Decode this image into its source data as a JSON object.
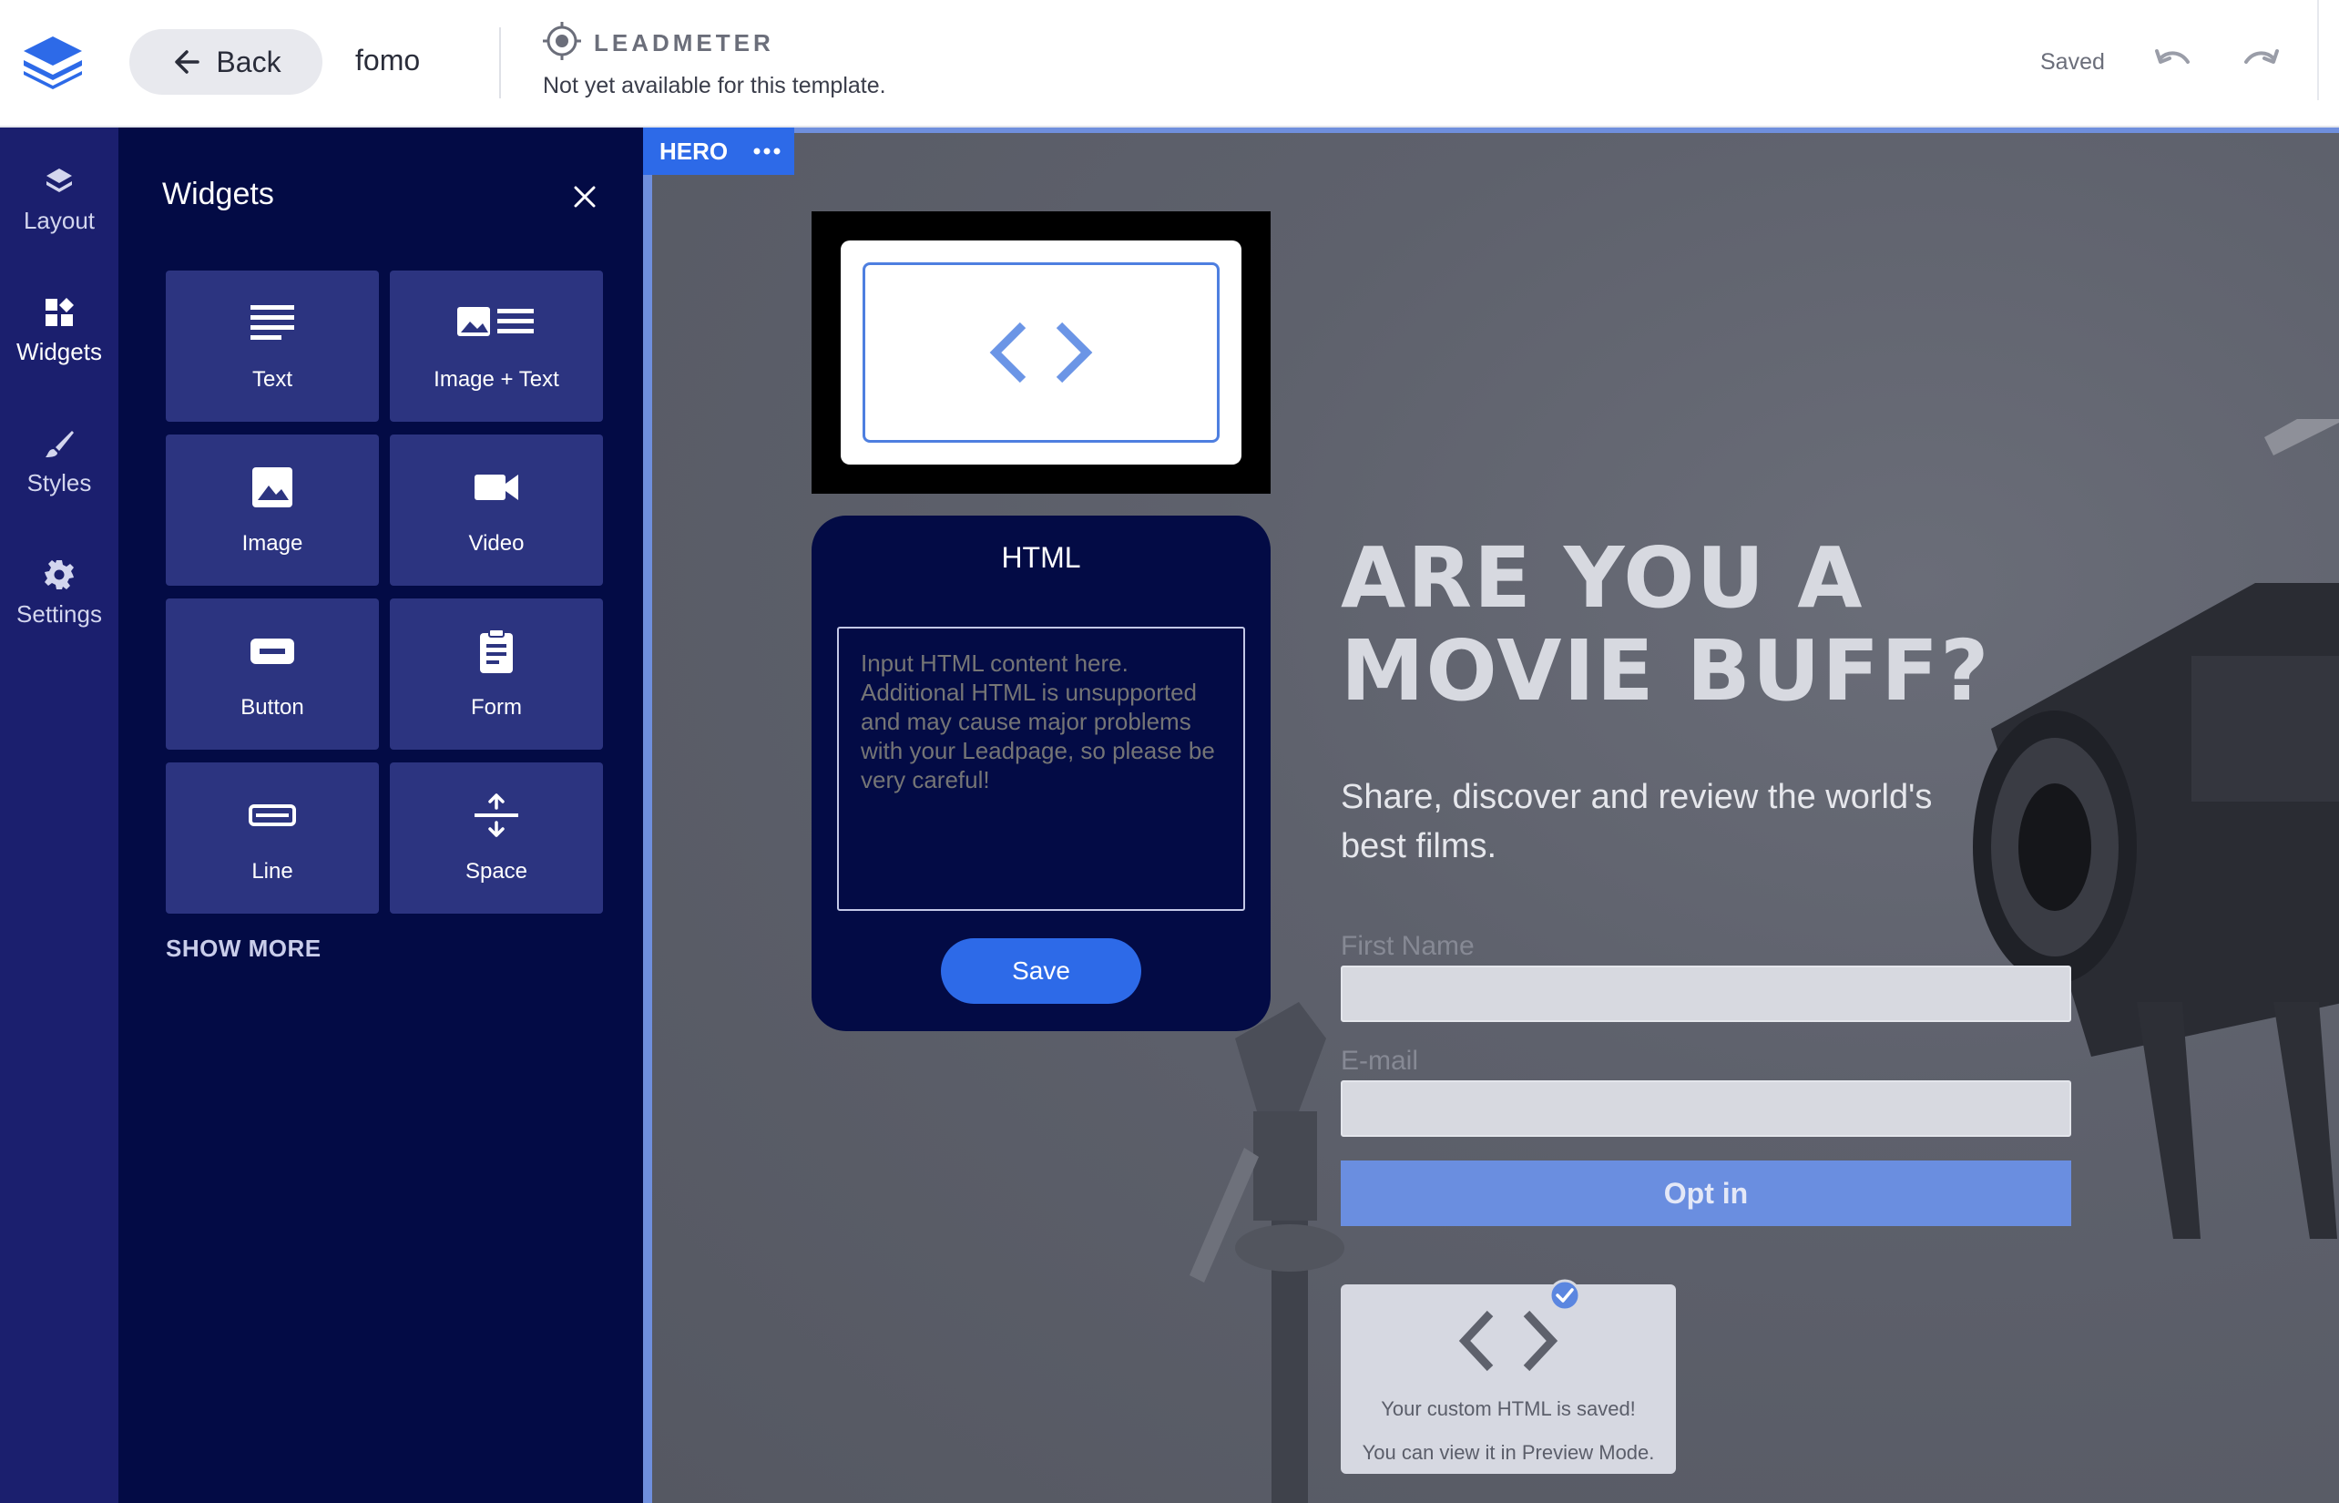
{
  "topbar": {
    "back_label": "Back",
    "page_name": "fomo",
    "leadmeter_title": "LEADMETER",
    "leadmeter_status": "Not yet available for this template.",
    "save_status": "Saved"
  },
  "rail": {
    "items": [
      {
        "label": "Layout",
        "icon": "layers-icon"
      },
      {
        "label": "Widgets",
        "icon": "widgets-icon"
      },
      {
        "label": "Styles",
        "icon": "brush-icon"
      },
      {
        "label": "Settings",
        "icon": "gear-icon"
      }
    ],
    "active": "Widgets"
  },
  "widgets_panel": {
    "title": "Widgets",
    "tiles": [
      {
        "label": "Text",
        "icon": "text-lines-icon"
      },
      {
        "label": "Image + Text",
        "icon": "image-text-icon"
      },
      {
        "label": "Image",
        "icon": "image-icon"
      },
      {
        "label": "Video",
        "icon": "video-icon"
      },
      {
        "label": "Button",
        "icon": "button-icon"
      },
      {
        "label": "Form",
        "icon": "clipboard-icon"
      },
      {
        "label": "Line",
        "icon": "line-icon"
      },
      {
        "label": "Space",
        "icon": "space-icon"
      }
    ],
    "show_more": "SHOW MORE"
  },
  "canvas": {
    "section_tag": "HERO",
    "html_editor": {
      "title": "HTML",
      "placeholder": "Input HTML content here. Additional HTML is unsupported and may cause major problems with your Leadpage, so please be very careful!",
      "save_label": "Save"
    },
    "hero": {
      "headline_line1": "ARE YOU A",
      "headline_line2": "MOVIE BUFF?",
      "subheadline": "Share, discover and review the world's best films.",
      "form": {
        "first_name_label": "First Name",
        "email_label": "E-mail",
        "submit_label": "Opt in"
      },
      "saved_card": {
        "line1": "Your custom HTML is saved!",
        "line2": "You can view it in Preview Mode."
      }
    }
  },
  "colors": {
    "accent": "#2d6ae8",
    "rail_bg": "#1b1f6e",
    "panel_bg": "#030b45",
    "tile_bg": "#2c3480"
  }
}
